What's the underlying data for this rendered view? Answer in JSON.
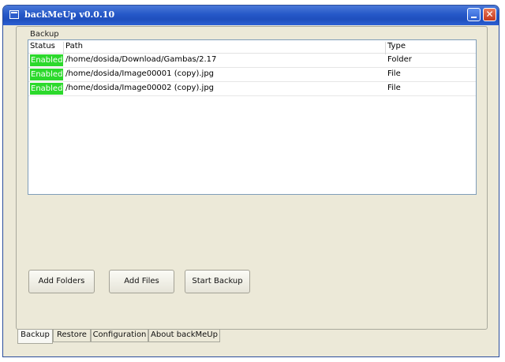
{
  "window": {
    "title": "backMeUp v0.0.10"
  },
  "backup": {
    "group_label": "Backup",
    "columns": [
      "Status",
      "Path",
      "Type"
    ],
    "rows": [
      {
        "status": "Enabled",
        "path": "/home/dosida/Download/Gambas/2.17",
        "type": "Folder"
      },
      {
        "status": "Enabled",
        "path": "/home/dosida/Image00001 (copy).jpg",
        "type": "File"
      },
      {
        "status": "Enabled",
        "path": "/home/dosida/Image00002 (copy).jpg",
        "type": "File"
      }
    ],
    "buttons": {
      "add_folders": "Add Folders",
      "add_files": "Add Files",
      "start_backup": "Start Backup"
    }
  },
  "tabs": [
    {
      "label": "Backup",
      "active": true
    },
    {
      "label": "Restore",
      "active": false
    },
    {
      "label": "Configuration",
      "active": false
    },
    {
      "label": "About backMeUp",
      "active": false
    }
  ],
  "colors": {
    "titlebar": "#2558c8",
    "enabled_status": "#2cd92c"
  },
  "icons": [
    "window-app-icon",
    "minimize-icon",
    "close-icon"
  ]
}
